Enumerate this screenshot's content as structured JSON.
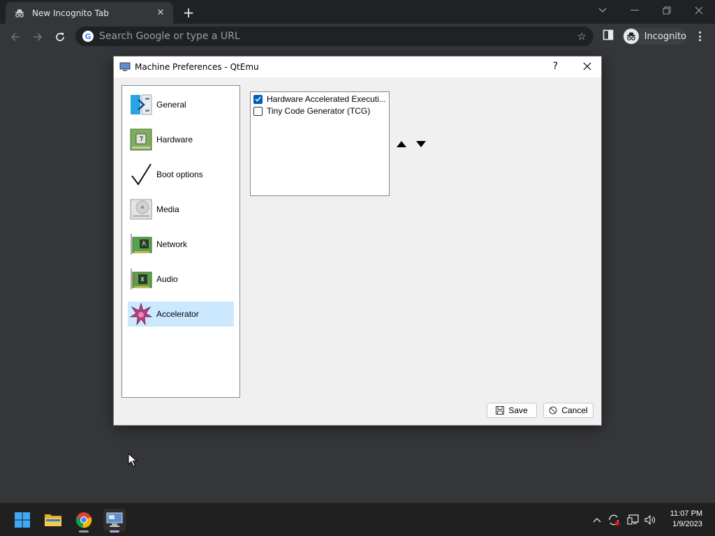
{
  "browser": {
    "tab_title": "New Incognito Tab",
    "omnibox_placeholder": "Search Google or type a URL",
    "profile_label": "Incognito"
  },
  "dialog": {
    "title": "Machine Preferences - QtEmu",
    "help_label": "?",
    "categories": [
      {
        "label": "General",
        "icon": "general-icon"
      },
      {
        "label": "Hardware",
        "icon": "hardware-icon"
      },
      {
        "label": "Boot options",
        "icon": "checkmark-icon"
      },
      {
        "label": "Media",
        "icon": "disk-drive-icon"
      },
      {
        "label": "Network",
        "icon": "network-card-icon"
      },
      {
        "label": "Audio",
        "icon": "sound-card-icon"
      },
      {
        "label": "Accelerator",
        "icon": "accelerator-star-icon"
      }
    ],
    "selected_category": "Accelerator",
    "accelerators": [
      {
        "label": "Hardware Accelerated Executi...",
        "checked": true
      },
      {
        "label": "Tiny Code Generator (TCG)",
        "checked": false
      }
    ],
    "save_label": "Save",
    "cancel_label": "Cancel"
  },
  "taskbar": {
    "time": "11:07 PM",
    "date": "1/9/2023"
  },
  "colors": {
    "selection": "#cce8ff",
    "checkbox_checked": "#005fb8",
    "taskbar": "#202020",
    "browser_frame": "#202124"
  }
}
